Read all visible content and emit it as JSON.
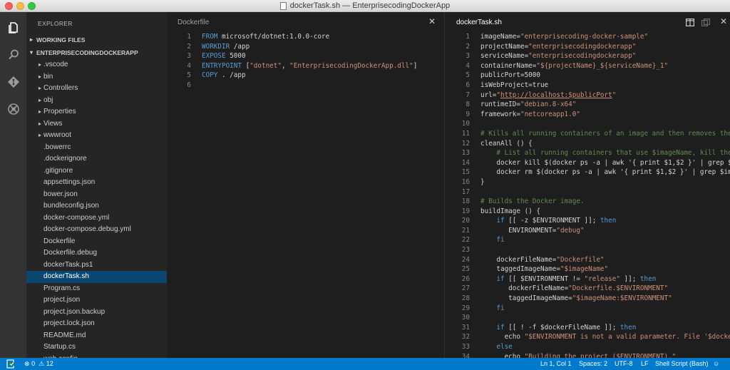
{
  "window": {
    "title": "dockerTask.sh — EnterprisecodingDockerApp"
  },
  "activity_bar": {
    "items": [
      "files-icon",
      "search-icon",
      "git-icon",
      "debug-icon"
    ]
  },
  "sidebar": {
    "title": "EXPLORER",
    "working_files": "WORKING FILES",
    "project": "ENTERPRISECODINGDOCKERAPP",
    "folders": [
      ".vscode",
      "bin",
      "Controllers",
      "obj",
      "Properties",
      "Views",
      "wwwroot"
    ],
    "files": [
      ".bowerrc",
      ".dockerignore",
      ".gitignore",
      "appsettings.json",
      "bower.json",
      "bundleconfig.json",
      "docker-compose.yml",
      "docker-compose.debug.yml",
      "Dockerfile",
      "Dockerfile.debug",
      "dockerTask.ps1",
      "dockerTask.sh",
      "Program.cs",
      "project.json",
      "project.json.backup",
      "project.lock.json",
      "README.md",
      "Startup.cs",
      "web.config"
    ],
    "selected": "dockerTask.sh"
  },
  "editor_left": {
    "title": "Dockerfile",
    "lines": [
      [
        [
          "k",
          "FROM"
        ],
        [
          "t",
          " microsoft/dotnet:1.0.0-core"
        ]
      ],
      [
        [
          "k",
          "WORKDIR"
        ],
        [
          "t",
          " /app"
        ]
      ],
      [
        [
          "k",
          "EXPOSE"
        ],
        [
          "t",
          " 5000"
        ]
      ],
      [
        [
          "k",
          "ENTRYPOINT"
        ],
        [
          "t",
          " ["
        ],
        [
          "s",
          "\"dotnet\""
        ],
        [
          "t",
          ", "
        ],
        [
          "s",
          "\"EnterprisecodingDockerApp.dll\""
        ],
        [
          "t",
          "]"
        ]
      ],
      [
        [
          "k",
          "COPY"
        ],
        [
          "t",
          " . /app"
        ]
      ],
      []
    ]
  },
  "editor_right": {
    "title": "dockerTask.sh",
    "lines": [
      [
        [
          "t",
          "imageName="
        ],
        [
          "s",
          "\"enterprisecoding-docker-sample\""
        ]
      ],
      [
        [
          "t",
          "projectName="
        ],
        [
          "s",
          "\"enterprisecodingdockerapp\""
        ]
      ],
      [
        [
          "t",
          "serviceName="
        ],
        [
          "s",
          "\"enterprisecodingdockerapp\""
        ]
      ],
      [
        [
          "t",
          "containerName="
        ],
        [
          "s",
          "\"${projectName}_${serviceName}_1\""
        ]
      ],
      [
        [
          "t",
          "publicPort=5000"
        ]
      ],
      [
        [
          "t",
          "isWebProject=true"
        ]
      ],
      [
        [
          "t",
          "url="
        ],
        [
          "s",
          "\""
        ],
        [
          "u",
          "http://localhost:$publicPort"
        ],
        [
          "s",
          "\""
        ]
      ],
      [
        [
          "t",
          "runtimeID="
        ],
        [
          "s",
          "\"debian.8-x64\""
        ]
      ],
      [
        [
          "t",
          "framework="
        ],
        [
          "s",
          "\"netcoreapp1.0\""
        ]
      ],
      [],
      [
        [
          "c",
          "# Kills all running containers of an image and then removes them."
        ]
      ],
      [
        [
          "t",
          "cleanAll () {"
        ]
      ],
      [
        [
          "c",
          "    # List all running containers that use $imageName, kill them"
        ]
      ],
      [
        [
          "t",
          "    docker kill $(docker ps -a | awk '{ print $1,$2 }' | grep $imageName"
        ]
      ],
      [
        [
          "t",
          "    docker rm $(docker ps -a | awk '{ print $1,$2 }' | grep $imageName"
        ]
      ],
      [
        [
          "t",
          "}"
        ]
      ],
      [],
      [
        [
          "c",
          "# Builds the Docker image."
        ]
      ],
      [
        [
          "t",
          "buildImage () {"
        ]
      ],
      [
        [
          "t",
          "    "
        ],
        [
          "k",
          "if"
        ],
        [
          "t",
          " [[ -z $ENVIRONMENT ]]; "
        ],
        [
          "k",
          "then"
        ]
      ],
      [
        [
          "t",
          "       ENVIRONMENT="
        ],
        [
          "s",
          "\"debug\""
        ]
      ],
      [
        [
          "t",
          "    "
        ],
        [
          "k",
          "fi"
        ]
      ],
      [],
      [
        [
          "t",
          "    dockerFileName="
        ],
        [
          "s",
          "\"Dockerfile\""
        ]
      ],
      [
        [
          "t",
          "    taggedImageName="
        ],
        [
          "s",
          "\"$imageName\""
        ]
      ],
      [
        [
          "t",
          "    "
        ],
        [
          "k",
          "if"
        ],
        [
          "t",
          " [[ $ENVIRONMENT != "
        ],
        [
          "s",
          "\"release\""
        ],
        [
          "t",
          " ]]; "
        ],
        [
          "k",
          "then"
        ]
      ],
      [
        [
          "t",
          "       dockerFileName="
        ],
        [
          "s",
          "\"Dockerfile.$ENVIRONMENT\""
        ]
      ],
      [
        [
          "t",
          "       taggedImageName="
        ],
        [
          "s",
          "\"$imageName:$ENVIRONMENT\""
        ]
      ],
      [
        [
          "t",
          "    "
        ],
        [
          "k",
          "fi"
        ]
      ],
      [],
      [
        [
          "t",
          "    "
        ],
        [
          "k",
          "if"
        ],
        [
          "t",
          " [[ ! -f $dockerFileName ]]; "
        ],
        [
          "k",
          "then"
        ]
      ],
      [
        [
          "t",
          "      echo "
        ],
        [
          "s",
          "\"$ENVIRONMENT is not a valid parameter. File '$dockerFileName'"
        ]
      ],
      [
        [
          "t",
          "    "
        ],
        [
          "k",
          "else"
        ]
      ],
      [
        [
          "t",
          "      echo "
        ],
        [
          "s",
          "\"Building the project ($ENVIRONMENT).\""
        ]
      ]
    ]
  },
  "statusbar": {
    "errors": "0",
    "warnings": "12",
    "position": "Ln 1, Col 1",
    "indent": "Spaces: 2",
    "encoding": "UTF-8",
    "eol": "LF",
    "language": "Shell Script (Bash)"
  },
  "colors": {
    "keyword": "#569cd6",
    "string": "#ce9178",
    "comment": "#608b4e",
    "statusbar": "#007acc",
    "selection": "#094771"
  }
}
